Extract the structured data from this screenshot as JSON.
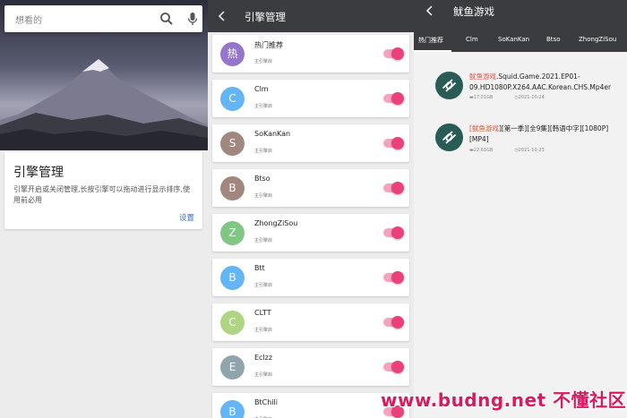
{
  "home": {
    "search": {
      "placeholder": "想看的"
    },
    "card": {
      "title": "引擎管理",
      "description": "引擎开启或关闭管理,长按引擎可以拖动进行显示排序,使用前必用",
      "link": "设置"
    }
  },
  "engines_screen": {
    "title": "引擎管理",
    "status_text": "主引擎启",
    "engines": [
      {
        "avatar": "热",
        "name": "热门推荐",
        "color": "#9575cd",
        "enabled": true
      },
      {
        "avatar": "C",
        "name": "Clm",
        "color": "#64b5f6",
        "enabled": true
      },
      {
        "avatar": "S",
        "name": "SoKanKan",
        "color": "#a1887f",
        "enabled": true
      },
      {
        "avatar": "B",
        "name": "Btso",
        "color": "#a1887f",
        "enabled": true
      },
      {
        "avatar": "Z",
        "name": "ZhongZiSou",
        "color": "#81c784",
        "enabled": true
      },
      {
        "avatar": "B",
        "name": "Btt",
        "color": "#64b5f6",
        "enabled": true
      },
      {
        "avatar": "C",
        "name": "CLTT",
        "color": "#aed581",
        "enabled": true
      },
      {
        "avatar": "E",
        "name": "Eclzz",
        "color": "#90a4ae",
        "enabled": true
      },
      {
        "avatar": "B",
        "name": "BtChili",
        "color": "#64b5f6",
        "enabled": true
      }
    ]
  },
  "search_results": {
    "title": "鱿鱼游戏",
    "tabs": [
      "热门推荐",
      "Clm",
      "SoKanKan",
      "Btso",
      "ZhongZiSou"
    ],
    "active_tab": 0,
    "results": [
      {
        "title_highlight": "鱿鱼游戏",
        "title_rest": ".Squid.Game.2021.EP01-09.HD1080P.X264.AAC.Korean.CHS.Mp4er",
        "size": "17.01GB",
        "date": "2021-10-24"
      },
      {
        "title_pre": "[",
        "title_highlight": "鱿鱼游戏",
        "title_rest": "][第一季][全9集][韩语中字][1080P][MP4]",
        "size": "22.61GB",
        "date": "2021-10-23"
      }
    ]
  },
  "watermark": "www.budng.net 不懂社区",
  "colors": {
    "toolbar": "#3a3c3f",
    "toggle": "#ec407a",
    "highlight": "#e0533d",
    "link": "#3b6fb6"
  },
  "icons": [
    "search-icon",
    "mic-icon",
    "back-arrow-icon",
    "magnet-icon",
    "folder-icon",
    "clock-icon"
  ]
}
